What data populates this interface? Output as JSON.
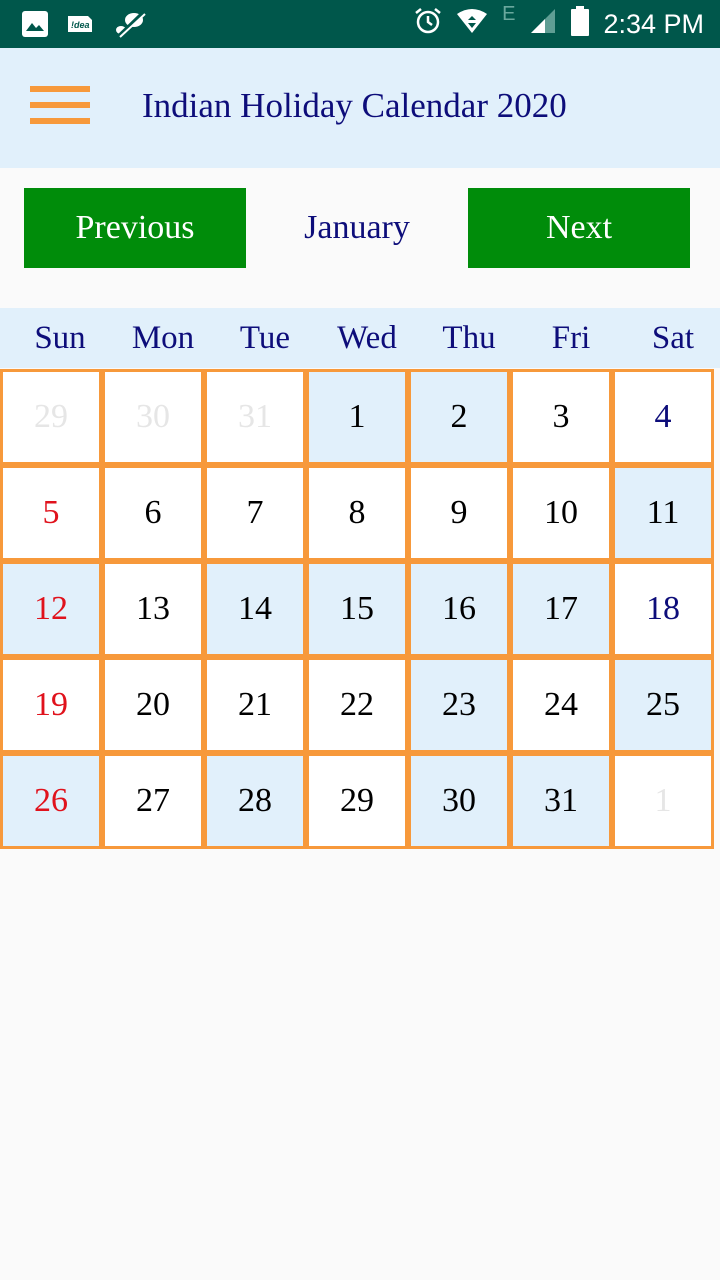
{
  "status_bar": {
    "left_icons": [
      "image-icon",
      "idea-sim-icon",
      "no-sync-icon"
    ],
    "idea_label": "!dea",
    "network_letter": "E",
    "right_icons": [
      "alarm-icon",
      "wifi-icon",
      "signal-icon",
      "battery-icon"
    ],
    "time": "2:34 PM"
  },
  "toolbar": {
    "menu_icon": "hamburger-menu-icon",
    "title": "Indian Holiday Calendar 2020"
  },
  "navigation": {
    "previous_label": "Previous",
    "month": "January",
    "next_label": "Next"
  },
  "colors": {
    "status_bar": "#00574b",
    "toolbar_bg": "#e1f0fb",
    "button_green": "#008c0a",
    "cell_border": "#f7993b",
    "sunday_red": "#e0121c",
    "saturday_blue": "#0d0d7a",
    "highlight_bg": "#e1f0fb",
    "muted_text": "#e6e6e6"
  },
  "calendar": {
    "weekdays": [
      "Sun",
      "Mon",
      "Tue",
      "Wed",
      "Thu",
      "Fri",
      "Sat"
    ],
    "weeks": [
      [
        {
          "day": "29",
          "style": "muted",
          "highlight": false
        },
        {
          "day": "30",
          "style": "muted",
          "highlight": false
        },
        {
          "day": "31",
          "style": "muted",
          "highlight": false
        },
        {
          "day": "1",
          "style": "normal",
          "highlight": true
        },
        {
          "day": "2",
          "style": "normal",
          "highlight": true
        },
        {
          "day": "3",
          "style": "normal",
          "highlight": false
        },
        {
          "day": "4",
          "style": "blue",
          "highlight": false
        }
      ],
      [
        {
          "day": "5",
          "style": "red",
          "highlight": false
        },
        {
          "day": "6",
          "style": "normal",
          "highlight": false
        },
        {
          "day": "7",
          "style": "normal",
          "highlight": false
        },
        {
          "day": "8",
          "style": "normal",
          "highlight": false
        },
        {
          "day": "9",
          "style": "normal",
          "highlight": false
        },
        {
          "day": "10",
          "style": "normal",
          "highlight": false
        },
        {
          "day": "11",
          "style": "normal",
          "highlight": true
        }
      ],
      [
        {
          "day": "12",
          "style": "red",
          "highlight": true
        },
        {
          "day": "13",
          "style": "normal",
          "highlight": false
        },
        {
          "day": "14",
          "style": "normal",
          "highlight": true
        },
        {
          "day": "15",
          "style": "normal",
          "highlight": true
        },
        {
          "day": "16",
          "style": "normal",
          "highlight": true
        },
        {
          "day": "17",
          "style": "normal",
          "highlight": true
        },
        {
          "day": "18",
          "style": "blue",
          "highlight": false
        }
      ],
      [
        {
          "day": "19",
          "style": "red",
          "highlight": false
        },
        {
          "day": "20",
          "style": "normal",
          "highlight": false
        },
        {
          "day": "21",
          "style": "normal",
          "highlight": false
        },
        {
          "day": "22",
          "style": "normal",
          "highlight": false
        },
        {
          "day": "23",
          "style": "normal",
          "highlight": true
        },
        {
          "day": "24",
          "style": "normal",
          "highlight": false
        },
        {
          "day": "25",
          "style": "normal",
          "highlight": true
        }
      ],
      [
        {
          "day": "26",
          "style": "red",
          "highlight": true
        },
        {
          "day": "27",
          "style": "normal",
          "highlight": false
        },
        {
          "day": "28",
          "style": "normal",
          "highlight": true
        },
        {
          "day": "29",
          "style": "normal",
          "highlight": false
        },
        {
          "day": "30",
          "style": "normal",
          "highlight": true
        },
        {
          "day": "31",
          "style": "normal",
          "highlight": true
        },
        {
          "day": "1",
          "style": "muted",
          "highlight": false
        }
      ]
    ]
  }
}
